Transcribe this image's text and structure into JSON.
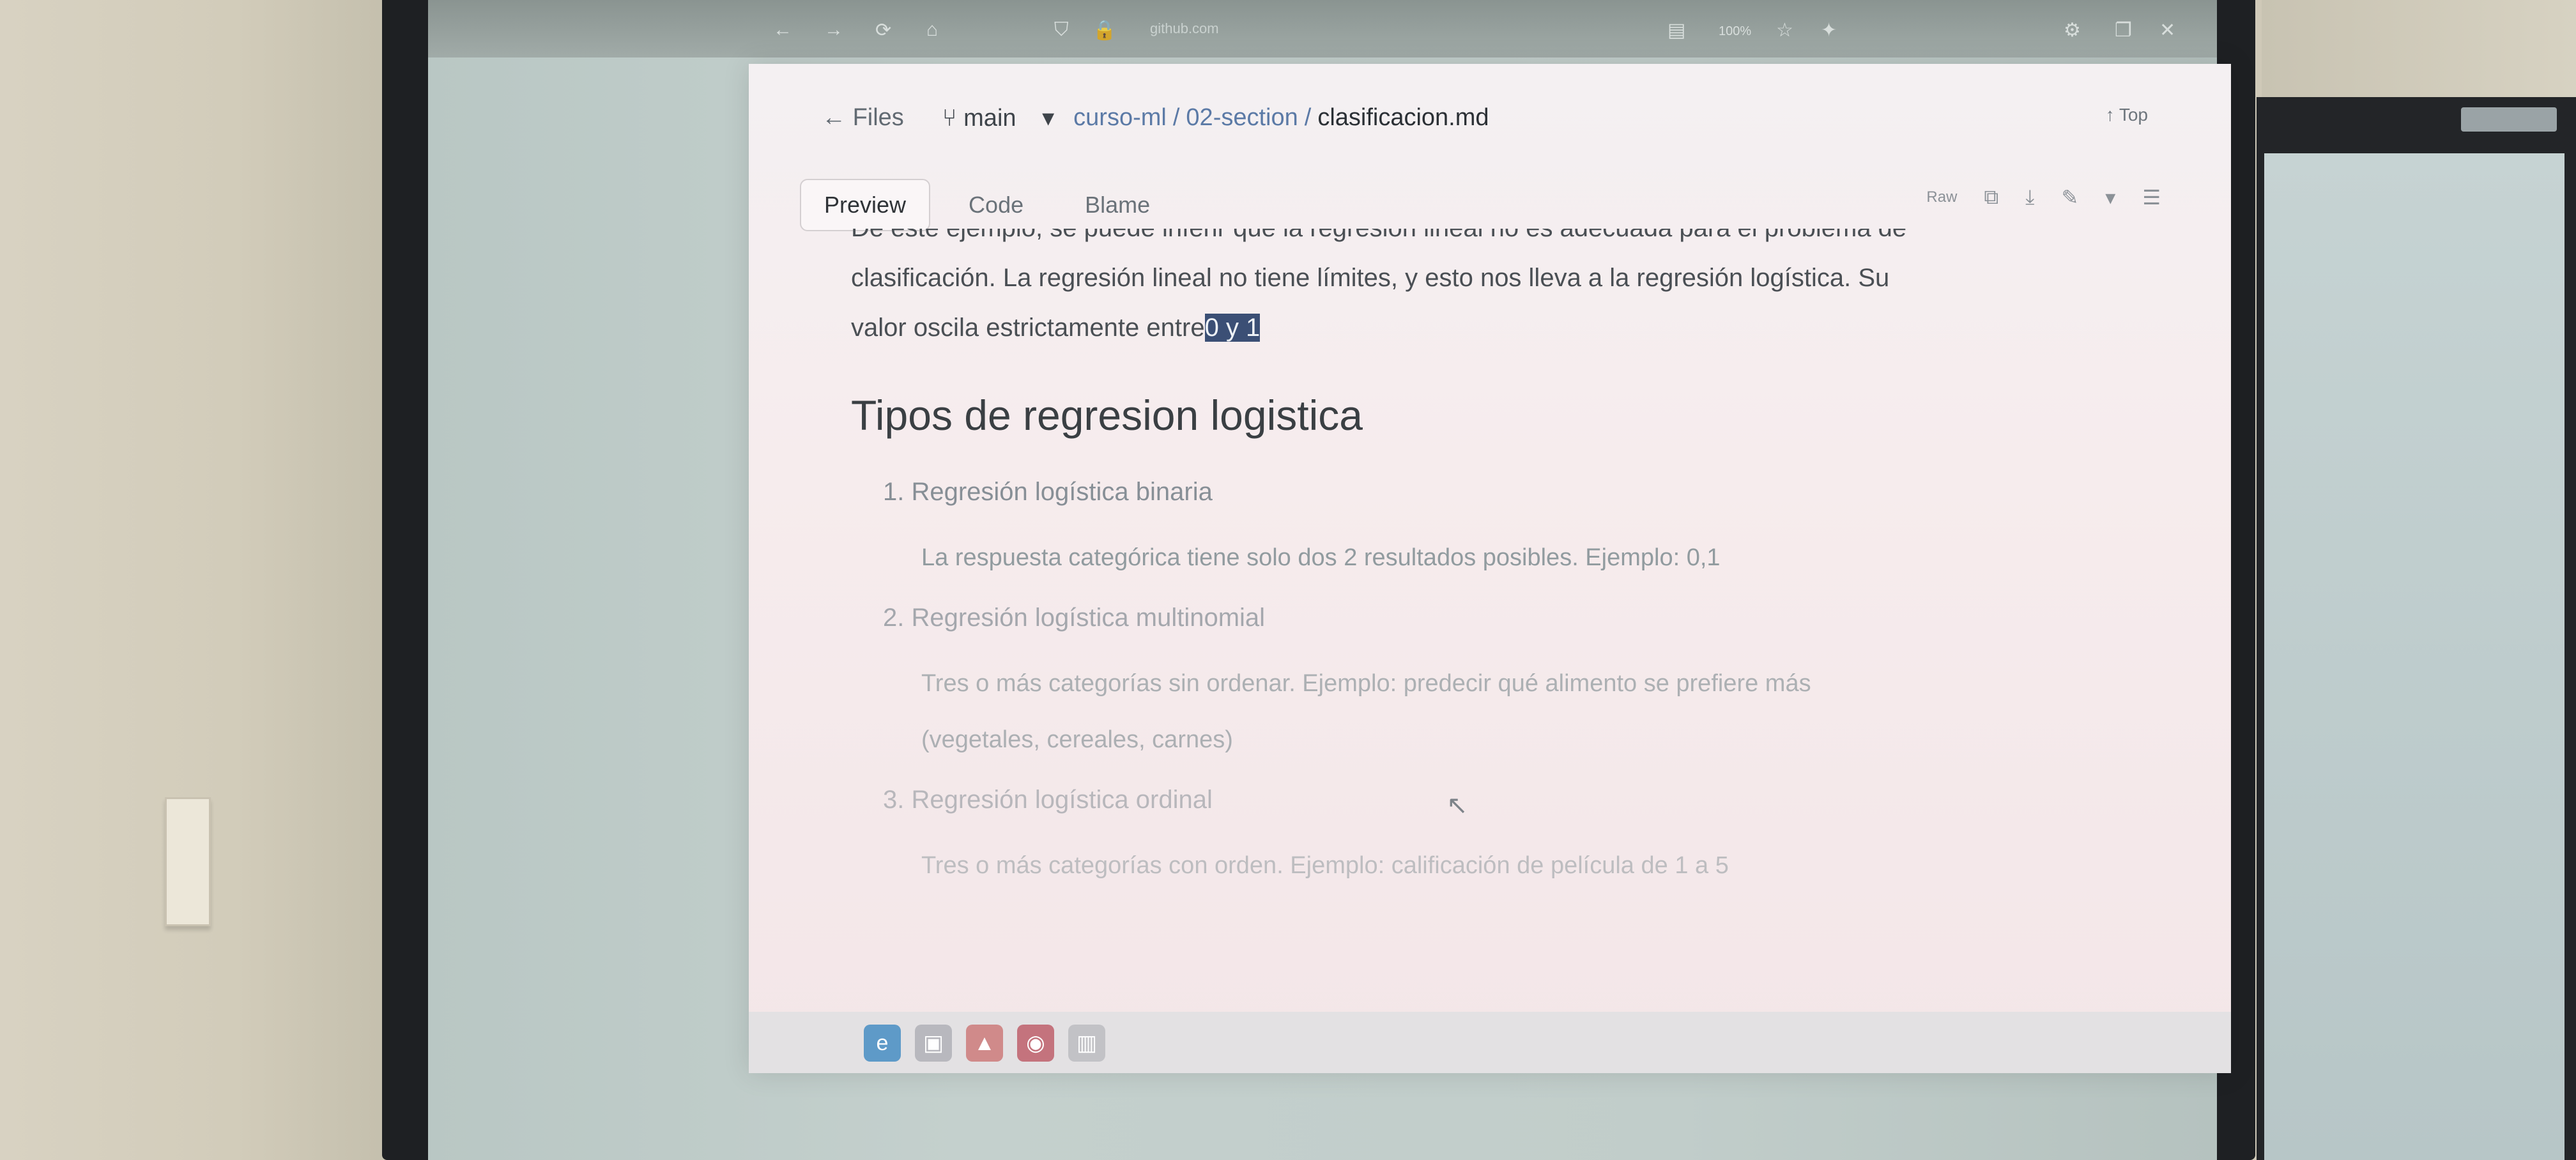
{
  "browser": {
    "url": "github.com",
    "zoom": "100%"
  },
  "window": {
    "breadcrumb": {
      "back_label": "Files",
      "branch_label": "main",
      "path_repo": "curso-ml",
      "path_sep": "/",
      "path_folder": "02-section",
      "path_sep2": "/",
      "file": "clasificacion.md"
    },
    "top_label": "Top",
    "tabs": [
      {
        "label": "Preview",
        "active": true
      },
      {
        "label": "Code",
        "active": false
      },
      {
        "label": "Blame",
        "active": false
      }
    ],
    "actions": {
      "raw": "Raw"
    }
  },
  "doc": {
    "line_cut": "De este ejemplo, se puede inferir que la regresión lineal no es adecuada para el problema de",
    "line2": "clasificación. La regresión lineal no tiene límites, y esto nos lleva a la regresión logística. Su",
    "line3_prefix": "valor oscila estrictamente entre",
    "line3_selected": "0 y 1",
    "heading": "Tipos de regresion logistica",
    "items": [
      {
        "title": "1. Regresión logística binaria",
        "body": "La respuesta categórica tiene solo dos 2 resultados posibles. Ejemplo: 0,1"
      },
      {
        "title": "2. Regresión logística multinomial",
        "body": "Tres o más categorías sin ordenar. Ejemplo: predecir qué alimento se prefiere más",
        "body2": "(vegetales, cereales, carnes)"
      },
      {
        "title": "3. Regresión logística ordinal",
        "body": "Tres o más categorías con orden. Ejemplo: calificación de película de 1 a 5"
      }
    ]
  },
  "colors": {
    "selection": "#3b4f75",
    "link": "#5b7aa6"
  }
}
